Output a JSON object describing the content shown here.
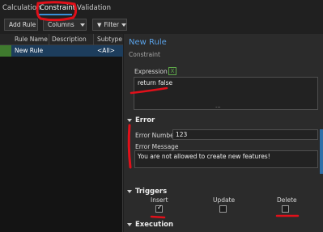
{
  "tabs": [
    {
      "label": "Calculation"
    },
    {
      "label": "Constraint"
    },
    {
      "label": "Validation"
    }
  ],
  "toolbar": {
    "add_rule": "Add Rule",
    "columns": "Columns",
    "filter": "Filter"
  },
  "grid": {
    "headers": [
      "Rule Name",
      "Description",
      "Subtype"
    ],
    "rows": [
      {
        "name": "New Rule",
        "description": "",
        "subtype": "<All>"
      }
    ]
  },
  "rule": {
    "title": "New Rule",
    "type": "Constraint",
    "expression_label": "Expression",
    "expression_icon_glyph": "X",
    "expression_value": "return false",
    "expression_more": "..."
  },
  "error": {
    "heading": "Error",
    "number_label": "Error Number",
    "number_value": "123",
    "message_label": "Error Message",
    "message_value": "You are not allowed to create new features!"
  },
  "triggers": {
    "heading": "Triggers",
    "items": [
      {
        "label": "Insert",
        "checked": true
      },
      {
        "label": "Update",
        "checked": false
      },
      {
        "label": "Delete",
        "checked": false
      }
    ]
  },
  "execution": {
    "heading": "Execution"
  },
  "colors": {
    "accent": "#5aa2e8",
    "annotation": "#e0101a",
    "selected_row": "#1d3d5c"
  }
}
